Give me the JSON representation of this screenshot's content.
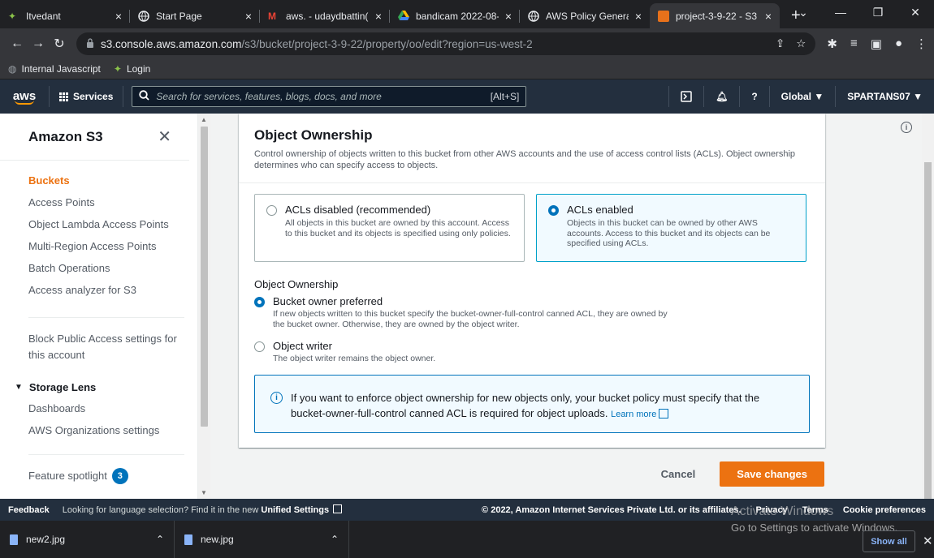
{
  "browser": {
    "tabs": [
      {
        "title": "Itvedant",
        "active": false
      },
      {
        "title": "Start Page",
        "active": false
      },
      {
        "title": "aws. - udaydbattin(",
        "active": false
      },
      {
        "title": "bandicam 2022-08-",
        "active": false
      },
      {
        "title": "AWS Policy Generat",
        "active": false
      },
      {
        "title": "project-3-9-22 - S3",
        "active": true
      }
    ],
    "url_host": "s3.console.aws.amazon.com",
    "url_path": "/s3/bucket/project-3-9-22/property/oo/edit?region=us-west-2",
    "bookmarks": [
      "Internal Javascript",
      "Login"
    ]
  },
  "aws_header": {
    "logo": "aws",
    "services_label": "Services",
    "search_placeholder": "Search for services, features, blogs, docs, and more",
    "search_shortcut": "[Alt+S]",
    "region": "Global ▼",
    "account": "SPARTANS07 ▼"
  },
  "sidebar": {
    "title": "Amazon S3",
    "items": [
      {
        "label": "Buckets",
        "active": true
      },
      {
        "label": "Access Points"
      },
      {
        "label": "Object Lambda Access Points"
      },
      {
        "label": "Multi-Region Access Points"
      },
      {
        "label": "Batch Operations"
      },
      {
        "label": "Access analyzer for S3"
      }
    ],
    "block_public": "Block Public Access settings for this account",
    "storage_lens": {
      "label": "Storage Lens",
      "items": [
        "Dashboards",
        "AWS Organizations settings"
      ]
    },
    "feature_spotlight": "Feature spotlight",
    "feature_count": "3"
  },
  "panel": {
    "title": "Object Ownership",
    "description": "Control ownership of objects written to this bucket from other AWS accounts and the use of access control lists (ACLs). Object ownership determines who can specify access to objects.",
    "acl_options": [
      {
        "title": "ACLs disabled (recommended)",
        "desc": "All objects in this bucket are owned by this account. Access to this bucket and its objects is specified using only policies.",
        "selected": false
      },
      {
        "title": "ACLs enabled",
        "desc": "Objects in this bucket can be owned by other AWS accounts. Access to this bucket and its objects can be specified using ACLs.",
        "selected": true
      }
    ],
    "ownership_label": "Object Ownership",
    "ownership_options": [
      {
        "title": "Bucket owner preferred",
        "desc": "If new objects written to this bucket specify the bucket-owner-full-control canned ACL, they are owned by the bucket owner. Otherwise, they are owned by the object writer.",
        "selected": true
      },
      {
        "title": "Object writer",
        "desc": "The object writer remains the object owner.",
        "selected": false
      }
    ],
    "info_text": "If you want to enforce object ownership for new objects only, your bucket policy must specify that the bucket-owner-full-control canned ACL is required for object uploads.",
    "learn_more": "Learn more"
  },
  "actions": {
    "cancel": "Cancel",
    "save": "Save changes"
  },
  "footer": {
    "feedback": "Feedback",
    "lang_text": "Looking for language selection? Find it in the new",
    "lang_link": "Unified Settings",
    "copyright": "© 2022, Amazon Internet Services Private Ltd. or its affiliates.",
    "privacy": "Privacy",
    "terms": "Terms",
    "cookies": "Cookie preferences"
  },
  "downloads": {
    "items": [
      "new2.jpg",
      "new.jpg"
    ],
    "show_all": "Show all"
  },
  "watermark": {
    "line1": "Activate Windows",
    "line2": "Go to Settings to activate Windows."
  },
  "colors": {
    "aws_navy": "#232f3e",
    "orange": "#ec7211",
    "blue": "#0073bb"
  }
}
